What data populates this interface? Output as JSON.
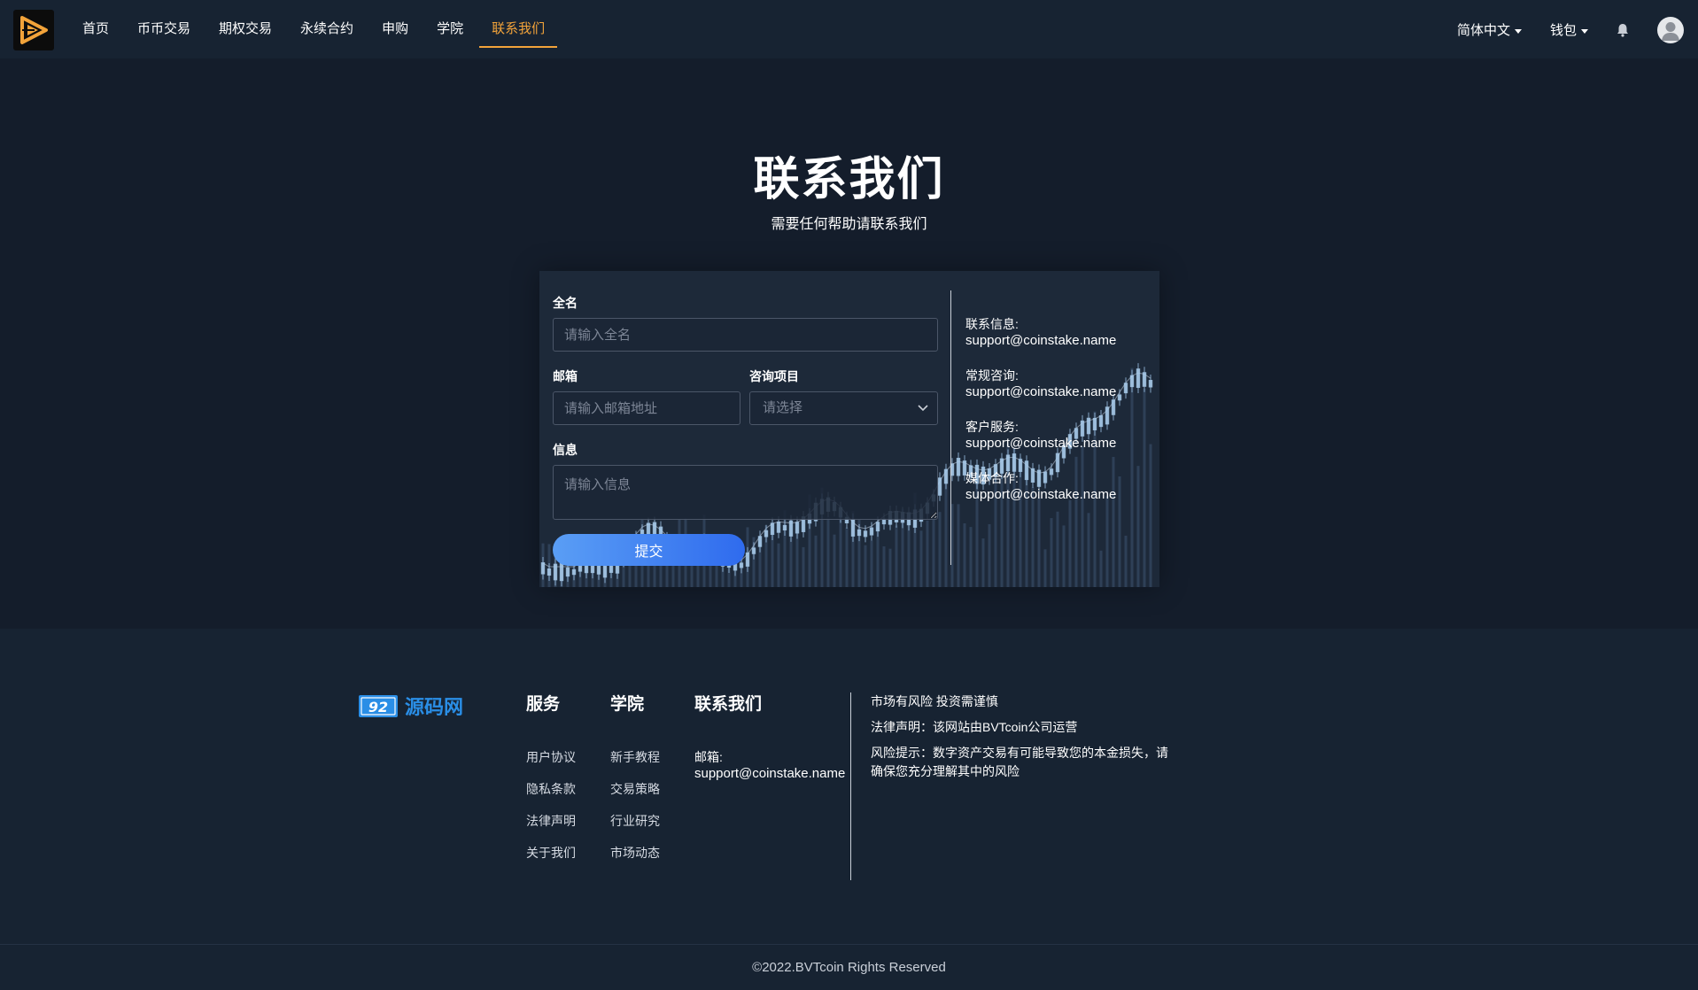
{
  "header": {
    "logo_alt": "logo",
    "nav": [
      {
        "label": "首页",
        "active": false
      },
      {
        "label": "币币交易",
        "active": false
      },
      {
        "label": "期权交易",
        "active": false
      },
      {
        "label": "永续合约",
        "active": false
      },
      {
        "label": "申购",
        "active": false
      },
      {
        "label": "学院",
        "active": false
      },
      {
        "label": "联系我们",
        "active": true
      }
    ],
    "language": "简体中文",
    "wallet": "钱包",
    "accent_color": "#f2a33a"
  },
  "hero": {
    "title": "联系我们",
    "subtitle": "需要任何帮助请联系我们"
  },
  "form": {
    "name_label": "全名",
    "name_placeholder": "请输入全名",
    "email_label": "邮箱",
    "email_placeholder": "请输入邮箱地址",
    "topic_label": "咨询项目",
    "topic_placeholder": "请选择",
    "message_label": "信息",
    "message_placeholder": "请输入信息",
    "submit_label": "提交",
    "submit_color": "#3d7cf0"
  },
  "contact_info": [
    {
      "label": "联系信息:",
      "value": "support@coinstake.name"
    },
    {
      "label": "常规咨询:",
      "value": "support@coinstake.name"
    },
    {
      "label": "客户服务:",
      "value": "support@coinstake.name"
    },
    {
      "label": "媒体合作:",
      "value": "support@coinstake.name"
    }
  ],
  "footer": {
    "logo_text": "源码网",
    "logo_badge": "92",
    "columns": [
      {
        "title": "服务",
        "links": [
          "用户协议",
          "隐私条款",
          "法律声明",
          "关于我们"
        ]
      },
      {
        "title": "学院",
        "links": [
          "新手教程",
          "交易策略",
          "行业研究",
          "市场动态"
        ]
      }
    ],
    "contact_title": "联系我们",
    "contact_email_label": "邮箱:",
    "contact_email": "support@coinstake.name",
    "notes": [
      "市场有风险 投资需谨慎",
      "法律声明：该网站由BVTcoin公司运营",
      "风险提示：数字资产交易有可能导致您的本金损失，请确保您充分理解其中的风险"
    ],
    "copyright": "©2022.BVTcoin Rights Reserved"
  }
}
